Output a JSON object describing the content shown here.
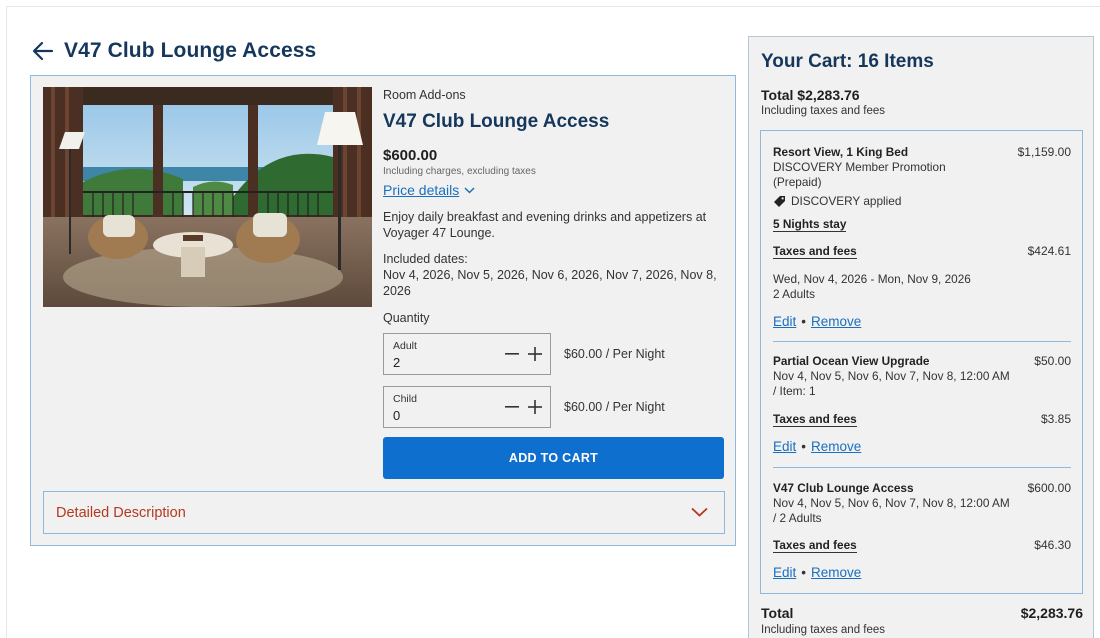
{
  "header": {
    "title": "V47 Club Lounge Access",
    "back_icon": "arrow-left-icon"
  },
  "product": {
    "category": "Room Add-ons",
    "name": "V47 Club Lounge Access",
    "price": "$600.00",
    "price_note": "Including charges, excluding taxes",
    "price_details_label": "Price details",
    "description": "Enjoy daily breakfast and evening drinks and appetizers at Voyager 47 Lounge.",
    "included_label": "Included dates:",
    "included_dates": "Nov 4, 2026, Nov 5, 2026, Nov 6, 2026, Nov 7, 2026, Nov 8, 2026",
    "quantity_label": "Quantity",
    "adult": {
      "label": "Adult",
      "value": "2",
      "price": "$60.00 / Per Night"
    },
    "child": {
      "label": "Child",
      "value": "0",
      "price": "$60.00 / Per Night"
    },
    "add_to_cart_label": "ADD TO CART",
    "detailed_description_label": "Detailed Description"
  },
  "cart": {
    "title": "Your Cart: 16 Items",
    "total_top": "Total $2,283.76",
    "total_note": "Including taxes and fees",
    "items": [
      {
        "name": "Resort View, 1 King Bed",
        "price": "$1,159.00",
        "subtitle": "DISCOVERY Member Promotion (Prepaid)",
        "tag": "DISCOVERY applied",
        "nights": "5 Nights stay",
        "taxes_label": "Taxes and fees",
        "taxes_value": "$424.61",
        "dates": "Wed, Nov 4, 2026 - Mon, Nov 9, 2026",
        "guests": "2 Adults",
        "edit": "Edit",
        "remove": "Remove"
      },
      {
        "name": "Partial Ocean View Upgrade",
        "price": "$50.00",
        "details": "Nov 4, Nov 5, Nov 6, Nov 7, Nov 8, 12:00 AM / Item: 1",
        "taxes_label": "Taxes and fees",
        "taxes_value": "$3.85",
        "edit": "Edit",
        "remove": "Remove"
      },
      {
        "name": "V47 Club Lounge Access",
        "price": "$600.00",
        "details": "Nov 4, Nov 5, Nov 6, Nov 7, Nov 8, 12:00 AM / 2 Adults",
        "taxes_label": "Taxes and fees",
        "taxes_value": "$46.30",
        "edit": "Edit",
        "remove": "Remove"
      }
    ],
    "total_label": "Total",
    "total_value": "$2,283.76",
    "total_bottom_note": "Including taxes and fees"
  },
  "colors": {
    "title_navy": "#15375c",
    "link_blue": "#1a6fbf",
    "button_blue": "#0f6fcf",
    "accent_red": "#b3391f",
    "panel_bg": "#f1f1f1",
    "border_blue": "#8fb8dd"
  }
}
